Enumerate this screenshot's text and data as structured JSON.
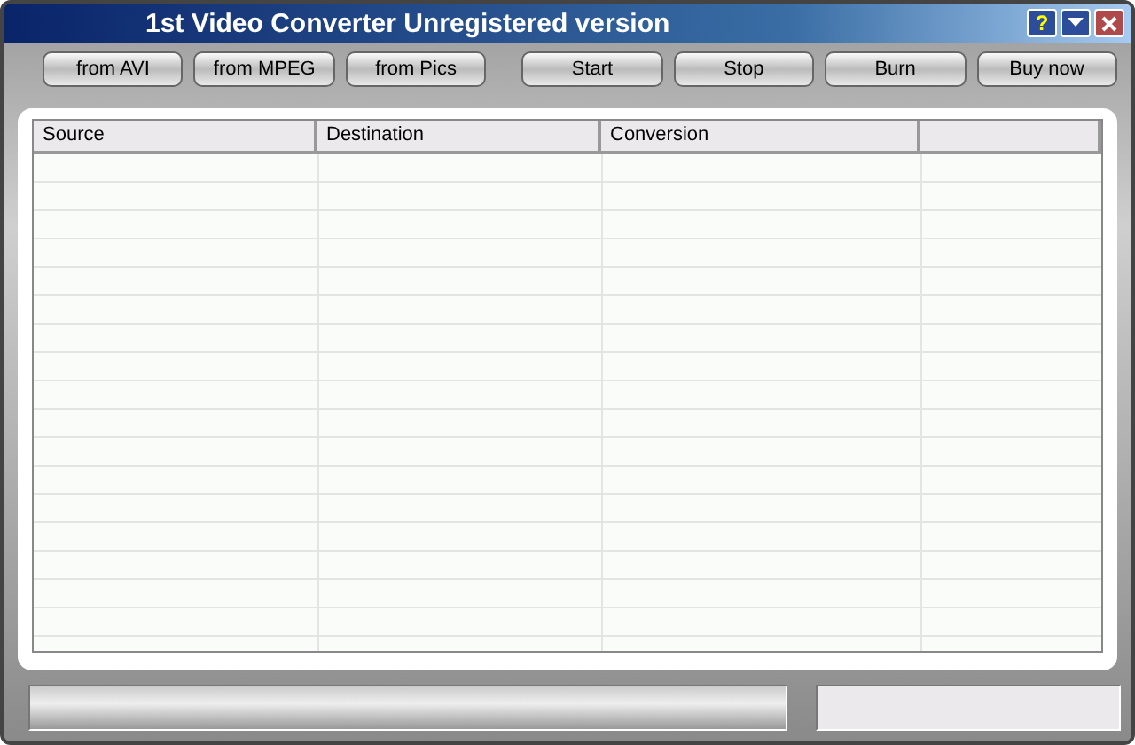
{
  "window": {
    "title": "1st Video Converter Unregistered version",
    "controls": [
      {
        "kind": "help",
        "label": "?"
      },
      {
        "kind": "minimize"
      },
      {
        "kind": "close"
      }
    ]
  },
  "toolbar": [
    {
      "label": "from AVI"
    },
    {
      "label": "from MPEG"
    },
    {
      "label": "from Pics"
    },
    {
      "label": "Start"
    },
    {
      "label": "Stop"
    },
    {
      "label": "Burn"
    },
    {
      "label": "Buy now"
    }
  ],
  "table": {
    "columns": [
      "Source",
      "Destination",
      "Conversion",
      ""
    ]
  }
}
